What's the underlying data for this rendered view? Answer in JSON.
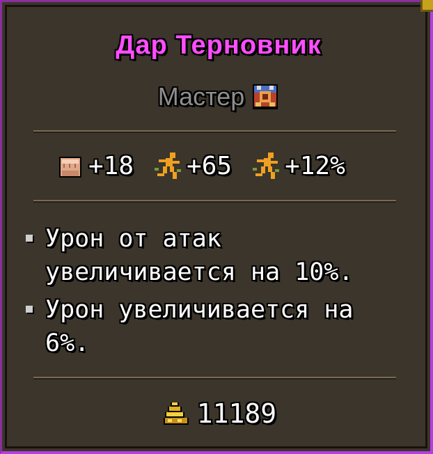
{
  "item": {
    "name": "Дар Терновник",
    "name_color": "#ff4dff",
    "rank": "Мастер",
    "rank_color": "#8e8e8e",
    "rank_icon": "armor-emblem-icon"
  },
  "stats": [
    {
      "icon": "fist-icon",
      "value": "+18"
    },
    {
      "icon": "running-figure-icon",
      "value": "+65"
    },
    {
      "icon": "running-figure-icon",
      "value": "+12%"
    }
  ],
  "effects": [
    {
      "text": "Урон от атак\nувеличивается на 10%."
    },
    {
      "text": "Урон увеличивается на\n6%."
    }
  ],
  "price": {
    "icon": "gold-coins-icon",
    "value": "11189"
  },
  "colors": {
    "panel_bg": "#3b352b",
    "border_purple": "#b43ee0",
    "text_white": "#ffffff"
  }
}
